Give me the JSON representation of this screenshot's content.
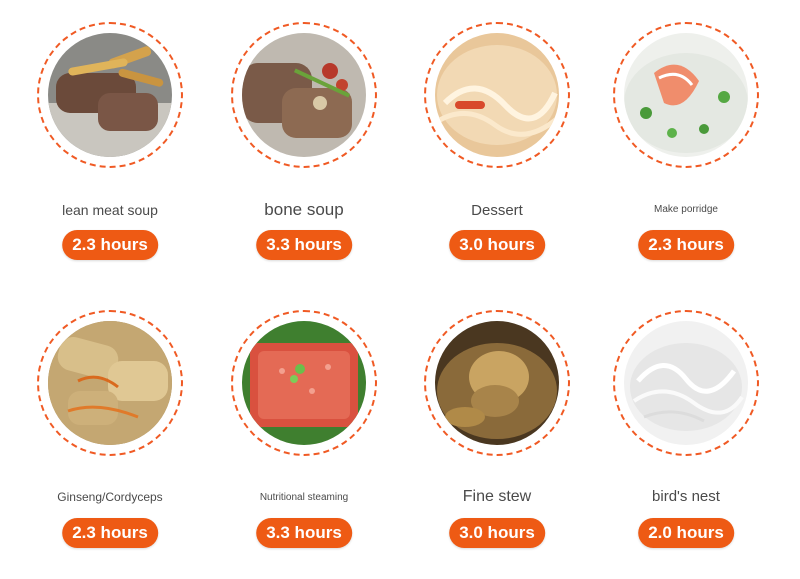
{
  "items": [
    {
      "name": "lean meat soup",
      "time": "2.3 hours",
      "image": "lean-meat-soup-photo"
    },
    {
      "name": "bone soup",
      "time": "3.3 hours",
      "image": "bone-soup-photo"
    },
    {
      "name": "Dessert",
      "time": "3.0 hours",
      "image": "dessert-photo"
    },
    {
      "name": "Make porridge",
      "time": "2.3 hours",
      "image": "porridge-photo"
    },
    {
      "name": "Ginseng/Cordyceps",
      "time": "2.3 hours",
      "image": "ginseng-cordyceps-photo"
    },
    {
      "name": "Nutritional steaming",
      "time": "3.3 hours",
      "image": "nutritional-steaming-photo"
    },
    {
      "name": "Fine stew",
      "time": "3.0 hours",
      "image": "fine-stew-photo"
    },
    {
      "name": "bird's nest",
      "time": "2.0 hours",
      "image": "birds-nest-photo"
    }
  ],
  "colors": {
    "accent": "#ee5a14",
    "ring": "#f05a24",
    "label": "#4a4a4a"
  }
}
